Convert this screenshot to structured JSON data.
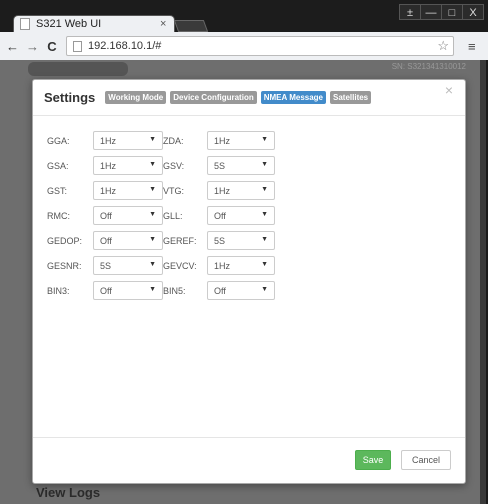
{
  "browser": {
    "tab_title": "S321 Web UI",
    "tab_close": "×",
    "address": "192.168.10.1/#",
    "window_controls": [
      "±",
      "—",
      "□",
      "X"
    ],
    "nav": [
      "←",
      "→",
      "C"
    ],
    "star": "☆",
    "menu": "≡"
  },
  "page": {
    "serial": "SN: S321341310012",
    "view_logs": "View Logs"
  },
  "modal": {
    "title": "Settings",
    "tabs": [
      "Working Mode",
      "Device Configuration",
      "NMEA Message",
      "Satellites"
    ],
    "active_tab": "NMEA Message",
    "close": "×",
    "rows": [
      {
        "label1": "GGA:",
        "value1": "1Hz",
        "label2": "ZDA:",
        "value2": "1Hz"
      },
      {
        "label1": "GSA:",
        "value1": "1Hz",
        "label2": "GSV:",
        "value2": "5S"
      },
      {
        "label1": "GST:",
        "value1": "1Hz",
        "label2": "VTG:",
        "value2": "1Hz"
      },
      {
        "label1": "RMC:",
        "value1": "Off",
        "label2": "GLL:",
        "value2": "Off"
      },
      {
        "label1": "GEDOP:",
        "value1": "Off",
        "label2": "GEREF:",
        "value2": "5S"
      },
      {
        "label1": "GESNR:",
        "value1": "5S",
        "label2": "GEVCV:",
        "value2": "1Hz"
      },
      {
        "label1": "BIN3:",
        "value1": "Off",
        "label2": "BIN5:",
        "value2": "Off"
      }
    ],
    "caret": "▼",
    "save_label": "Save",
    "cancel_label": "Cancel"
  },
  "colors": {
    "active_tab": "#428bca",
    "inactive_tab": "#999999",
    "save": "#5cb85c"
  }
}
